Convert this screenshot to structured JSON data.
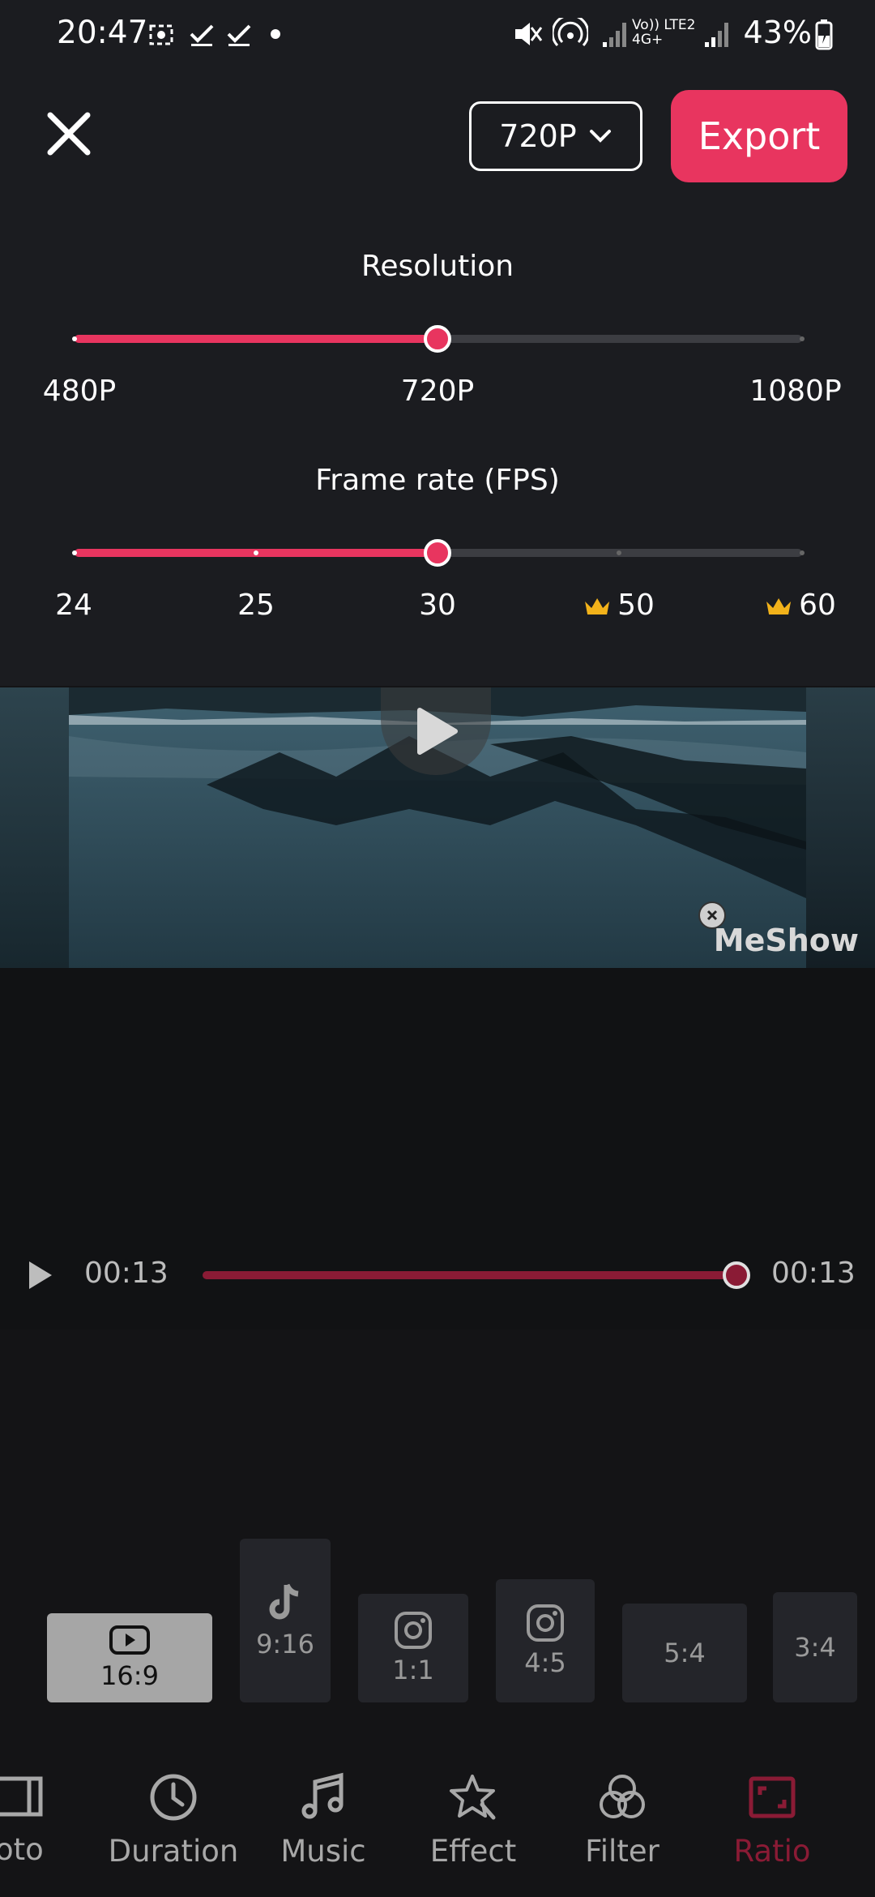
{
  "status_bar": {
    "time": "20:47",
    "network": "Vo)) LTE2 4G+",
    "battery": "43%"
  },
  "header": {
    "resolution_selected": "720P",
    "export_label": "Export"
  },
  "resolution": {
    "title": "Resolution",
    "options": [
      "480P",
      "720P",
      "1080P"
    ],
    "selected_index": 1
  },
  "frame_rate": {
    "title": "Frame rate (FPS)",
    "options": [
      "24",
      "25",
      "30",
      "50",
      "60"
    ],
    "premium": [
      false,
      false,
      false,
      true,
      true
    ],
    "selected_index": 2
  },
  "preview": {
    "watermark": "MeShow"
  },
  "playback": {
    "current_time": "00:13",
    "total_time": "00:13",
    "progress": 1.0
  },
  "ratios": [
    {
      "label": "16:9",
      "icon": "youtube-icon",
      "selected": true
    },
    {
      "label": "9:16",
      "icon": "tiktok-icon",
      "selected": false
    },
    {
      "label": "1:1",
      "icon": "instagram-icon",
      "selected": false
    },
    {
      "label": "4:5",
      "icon": "instagram-icon",
      "selected": false
    },
    {
      "label": "5:4",
      "icon": "",
      "selected": false
    },
    {
      "label": "3:4",
      "icon": "",
      "selected": false
    }
  ],
  "nav": [
    {
      "label": "oto",
      "icon": "photo-icon",
      "active": false
    },
    {
      "label": "Duration",
      "icon": "clock-icon",
      "active": false
    },
    {
      "label": "Music",
      "icon": "music-note-icon",
      "active": false
    },
    {
      "label": "Effect",
      "icon": "star-effect-icon",
      "active": false
    },
    {
      "label": "Filter",
      "icon": "filter-circles-icon",
      "active": false
    },
    {
      "label": "Ratio",
      "icon": "ratio-frame-icon",
      "active": true
    }
  ],
  "colors": {
    "accent": "#e8355f",
    "accent_dark": "#8a1b35",
    "panel_bg": "#1b1c20",
    "premium_crown": "#f2b21a"
  }
}
